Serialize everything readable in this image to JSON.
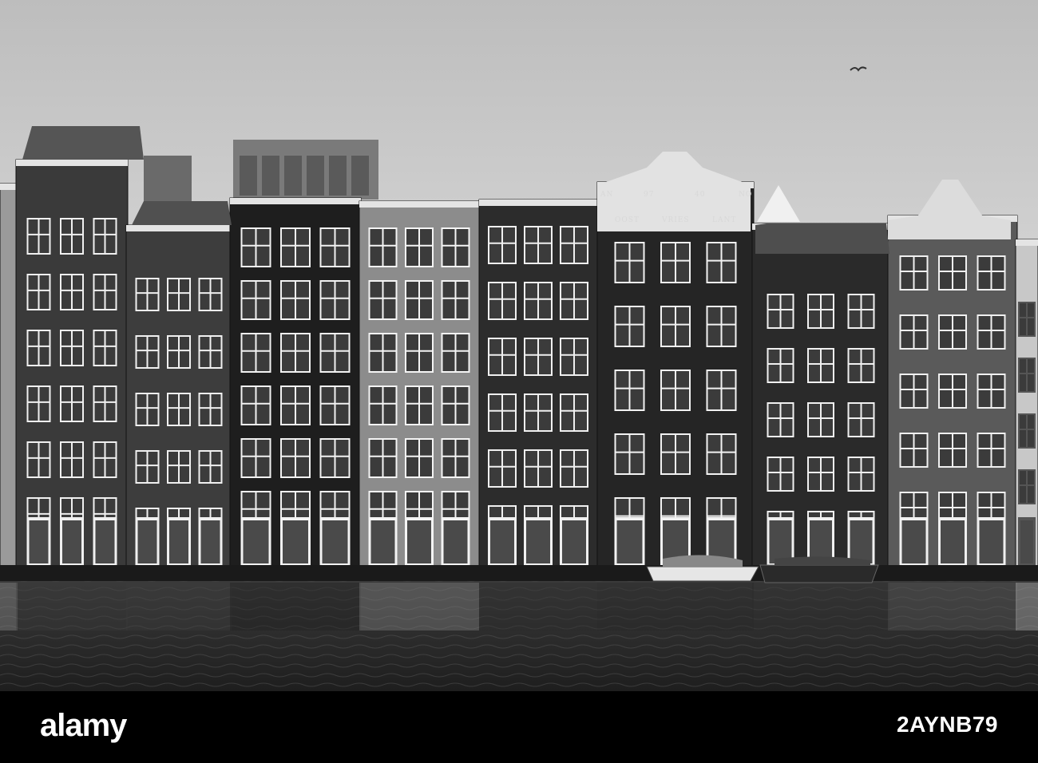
{
  "image": {
    "subject": "Row of Amsterdam canal houses on Damrak, black and white",
    "palette": {
      "sky": "#cfcfcf",
      "water": "#2a2a2a",
      "brick_dark": "#2f2f2f",
      "brick_light": "#7a7a7a",
      "trim": "#efefef"
    }
  },
  "gable_inscription": {
    "year_left": "AN",
    "year_mid1": "97",
    "year_mid2": "40",
    "year_right": "NO",
    "motto_1": "OOST",
    "motto_2": "VRIES",
    "motto_3": "LANT"
  },
  "footer": {
    "brand": "alamy",
    "image_id": "2AYNB79"
  }
}
